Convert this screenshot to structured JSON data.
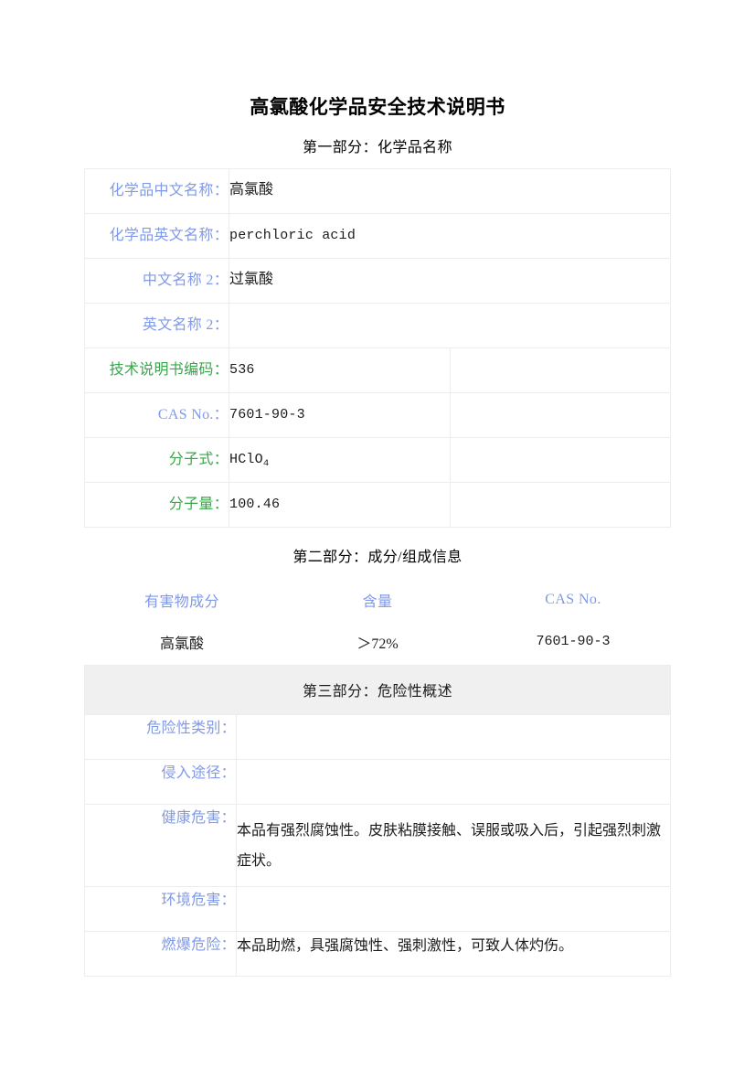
{
  "document": {
    "title": "高氯酸化学品安全技术说明书"
  },
  "section1": {
    "caption": "第一部分：化学品名称",
    "rows": [
      {
        "label": "化学品中文名称：",
        "value": "高氯酸",
        "label_color": "blue",
        "value_style": "cjk",
        "trailing_cell": false
      },
      {
        "label": "化学品英文名称：",
        "value": "perchloric acid",
        "label_color": "blue",
        "value_style": "mono",
        "trailing_cell": false
      },
      {
        "label": "中文名称 2：",
        "value": "过氯酸",
        "label_color": "blue",
        "value_style": "cjk",
        "trailing_cell": false
      },
      {
        "label": "英文名称 2：",
        "value": "",
        "label_color": "blue",
        "value_style": "mono",
        "trailing_cell": false
      },
      {
        "label": "技术说明书编码：",
        "value": "536",
        "label_color": "green",
        "value_style": "mono",
        "trailing_cell": true
      },
      {
        "label": "CAS No.：",
        "value": "7601-90-3",
        "label_color": "blue",
        "value_style": "mono",
        "trailing_cell": true
      },
      {
        "label": "分子式：",
        "value": "HClO",
        "value_sub": "4",
        "label_color": "green",
        "value_style": "mono",
        "trailing_cell": true
      },
      {
        "label": "分子量：",
        "value": "100.46",
        "label_color": "green",
        "value_style": "mono",
        "trailing_cell": true
      }
    ]
  },
  "section2": {
    "caption": "第二部分：成分/组成信息",
    "headers": [
      "有害物成分",
      "含量",
      "CAS No."
    ],
    "rows": [
      {
        "component": "高氯酸",
        "content": "＞72%",
        "cas": "7601-90-3"
      }
    ]
  },
  "section3": {
    "banner": "第三部分：危险性概述",
    "rows": [
      {
        "label": "危险性类别：",
        "value": ""
      },
      {
        "label": "侵入途径：",
        "value": ""
      },
      {
        "label": "健康危害：",
        "value": "本品有强烈腐蚀性。皮肤粘膜接触、误服或吸入后，引起强烈刺激症状。"
      },
      {
        "label": "环境危害：",
        "value": ""
      },
      {
        "label": "燃爆危险：",
        "value": "本品助燃，具强腐蚀性、强刺激性，可致人体灼伤。"
      }
    ]
  },
  "colors": {
    "label_blue": "#8099e8",
    "label_green": "#37a74a",
    "banner_bg": "#f0f0f0",
    "border": "#eceded",
    "text": "#1b1b1b"
  }
}
